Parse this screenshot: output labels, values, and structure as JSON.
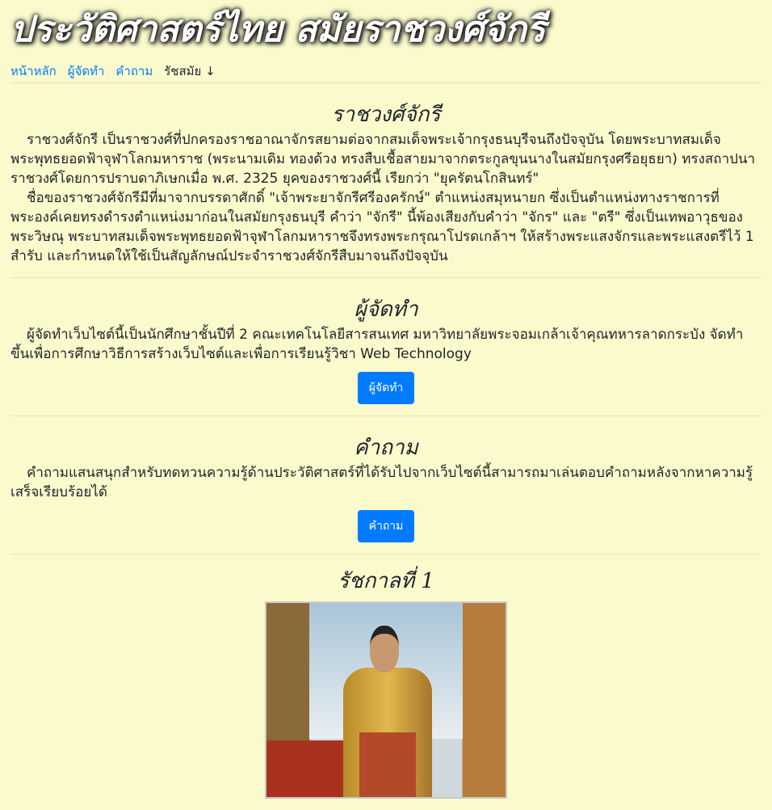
{
  "header": {
    "title": "ประวัติศาสตร์ไทย สมัยราชวงศ์จักรี"
  },
  "nav": {
    "items": [
      {
        "label": "หน้าหลัก"
      },
      {
        "label": "ผู้จัดทำ"
      },
      {
        "label": "คำถาม"
      }
    ],
    "dropdown": "รัชสมัย ↓"
  },
  "sections": {
    "dynasty": {
      "heading": "ราชวงศ์จักรี",
      "p1": "ราชวงศ์จักรี เป็นราชวงศ์ที่ปกครองราชอาณาจักรสยามต่อจากสมเด็จพระเจ้ากรุงธนบุรีจนถึงปัจจุบัน โดยพระบาทสมเด็จพระพุทธยอดฟ้าจุฬาโลกมหาราช (พระนามเดิม ทองด้วง ทรงสืบเชื้อสายมาจากตระกูลขุนนางในสมัยกรุงศรีอยุธยา) ทรงสถาปนาราชวงศ์โดยการปราบดาภิเษกเมื่อ พ.ศ. 2325 ยุคของราชวงศ์นี้ เรียกว่า \"ยุครัตนโกสินทร์\"",
      "p2": "ชื่อของราชวงศ์จักรีมีที่มาจากบรรดาศักดิ์ \"เจ้าพระยาจักรีศรีองครักษ์\" ตำแหน่งสมุหนายก ซึ่งเป็นตำแหน่งทางราชการที่พระองค์เคยทรงดำรงตำแหน่งมาก่อนในสมัยกรุงธนบุรี คำว่า \"จักรี\" นี้พ้องเสียงกับคำว่า \"จักร\" และ \"ตรี\" ซึ่งเป็นเทพอาวุธของพระวิษณุ พระบาทสมเด็จพระพุทธยอดฟ้าจุฬาโลกมหาราชจึงทรงพระกรุณาโปรดเกล้าฯ ให้สร้างพระแสงจักรและพระแสงตรีไว้ 1 สำรับ และกำหนดให้ใช้เป็นสัญลักษณ์ประจำราชวงศ์จักรีสืบมาจนถึงปัจจุบัน"
    },
    "authors": {
      "heading": "ผู้จัดทำ",
      "p1": "ผู้จัดทำเว็บไซต์นี้เป็นนักศึกษาชั้นปีที่ 2 คณะเทคโนโลยีสารสนเทศ มหาวิทยาลัยพระจอมเกล้าเจ้าคุณทหารลาดกระบัง จัดทำขึ้นเพื่อการศึกษาวิธีการสร้างเว็บไซต์และเพื่อการเรียนรู้วิชา Web Technology",
      "button": "ผู้จัดทำ"
    },
    "quiz": {
      "heading": "คำถาม",
      "p1": "คำถามแสนสนุกสำหรับทดทวนความรู้ด้านประวัติศาสตร์ที่ได้รับไปจากเว็บไซต์นี้สามารถมาเล่นตอบคำถามหลังจากหาความรู้เสร็จเรียบร้อยได้",
      "button": "คำถาม"
    },
    "reign1": {
      "heading": "รัชกาลที่ 1"
    }
  }
}
